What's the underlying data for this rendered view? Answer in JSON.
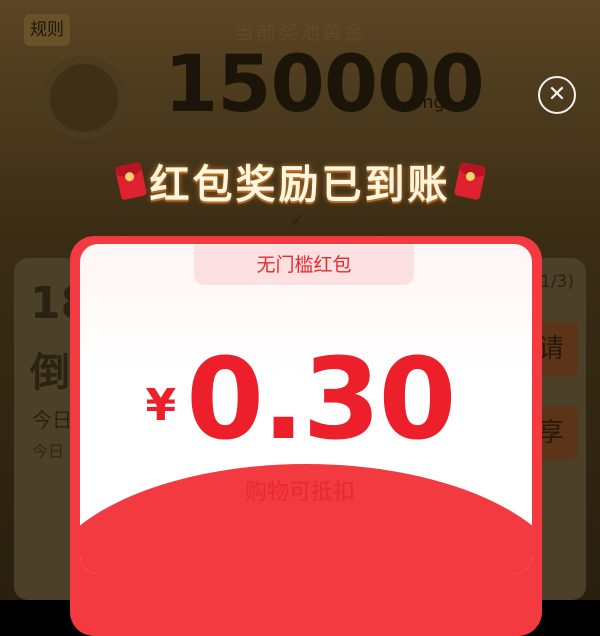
{
  "background": {
    "rules_button": "规则",
    "prize_label": "当前奖池黄金",
    "prize_amount": "150000",
    "prize_unit": "mg",
    "card_big_number": "18",
    "card_countdown": "倒",
    "card_today_1": "今日",
    "card_today_2": "今日",
    "progress": "1/3)",
    "button_apply": "请",
    "button_share": "享"
  },
  "popup": {
    "title": "红包奖励已到账",
    "tag": "无门槛红包",
    "currency": "¥",
    "value": "0.30",
    "subtitle": "购物可抵扣",
    "close_icon": "close-icon",
    "envelope_icon": "red-envelope-icon"
  },
  "colors": {
    "accent_red": "#f23a40",
    "text_red": "#ec1f2a"
  }
}
